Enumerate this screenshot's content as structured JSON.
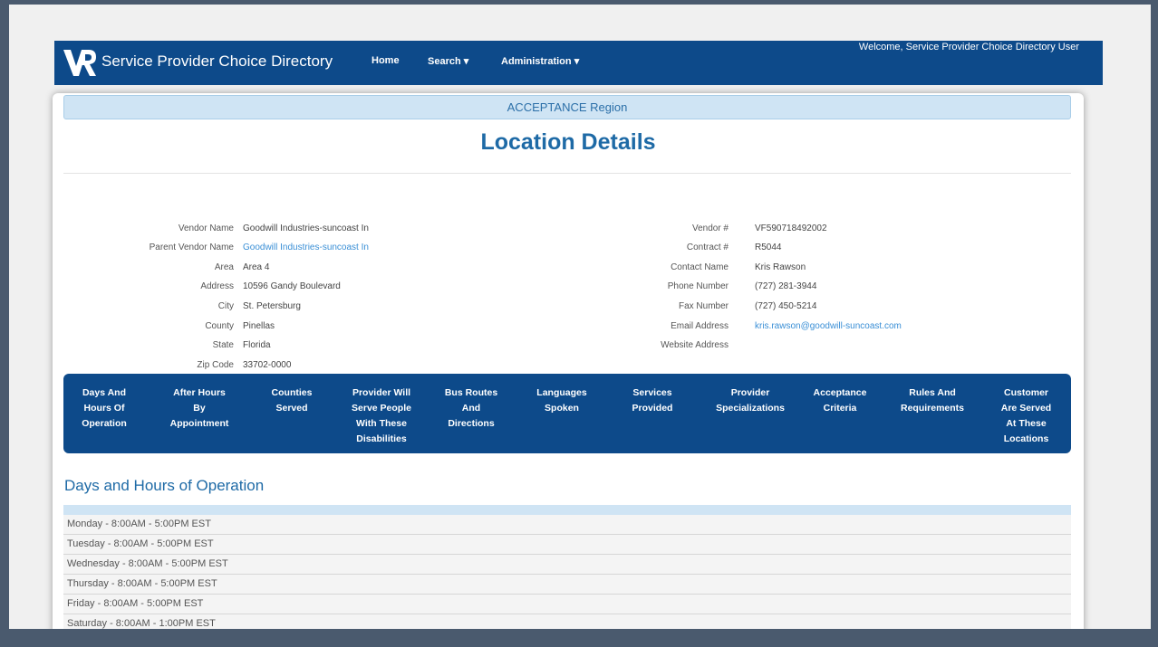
{
  "navbar": {
    "brand": "Service Provider Choice Directory",
    "home": "Home",
    "search": "Search",
    "administration": "Administration",
    "welcome": "Welcome, Service Provider Choice Directory User",
    "caret": "▾"
  },
  "region": "ACCEPTANCE Region",
  "title": "Location Details",
  "left_fields": [
    {
      "label": "Vendor Name",
      "value": "Goodwill Industries-suncoast In"
    },
    {
      "label": "Parent Vendor Name",
      "value": "Goodwill Industries-suncoast In"
    },
    {
      "label": "Area",
      "value": "Area 4"
    },
    {
      "label": "Address",
      "value": "10596 Gandy Boulevard"
    },
    {
      "label": "City",
      "value": "St. Petersburg"
    },
    {
      "label": "County",
      "value": "Pinellas"
    },
    {
      "label": "State",
      "value": "Florida"
    },
    {
      "label": "Zip Code",
      "value": "33702-0000"
    }
  ],
  "right_fields": [
    {
      "label": "Vendor #",
      "value": "VF590718492002"
    },
    {
      "label": "Contract #",
      "value": "R5044"
    },
    {
      "label": "Contact Name",
      "value": "Kris Rawson"
    },
    {
      "label": "Phone Number",
      "value": "(727) 281-3944"
    },
    {
      "label": "Fax Number",
      "value": "(727) 450-5214"
    },
    {
      "label": "Email Address",
      "value": "kris.rawson@goodwill-suncoast.com"
    },
    {
      "label": "Website Address",
      "value": ""
    }
  ],
  "tabs": [
    [
      "Days And",
      "Hours Of",
      "Operation"
    ],
    [
      "After Hours",
      "By",
      "Appointment"
    ],
    [
      "Counties",
      "Served"
    ],
    [
      "Provider Will",
      "Serve People",
      "With These",
      "Disabilities"
    ],
    [
      "Bus Routes",
      "And",
      "Directions"
    ],
    [
      "Languages",
      "Spoken"
    ],
    [
      "Services",
      "Provided"
    ],
    [
      "Provider",
      "Specializations"
    ],
    [
      "Acceptance",
      "Criteria"
    ],
    [
      "Rules And",
      "Requirements"
    ],
    [
      "Customer",
      "Are Served",
      "At These",
      "Locations"
    ]
  ],
  "section_title": "Days and Hours of Operation",
  "hours": [
    "Monday - 8:00AM - 5:00PM EST",
    "Tuesday - 8:00AM - 5:00PM EST",
    "Wednesday - 8:00AM - 5:00PM EST",
    "Thursday - 8:00AM - 5:00PM EST",
    "Friday - 8:00AM - 5:00PM EST",
    "Saturday - 8:00AM - 1:00PM EST"
  ],
  "colors": {
    "navbar": "#0d4a8a",
    "accent": "#1e6aa6",
    "link": "#3a8fd6",
    "region": "#cfe4f4"
  }
}
